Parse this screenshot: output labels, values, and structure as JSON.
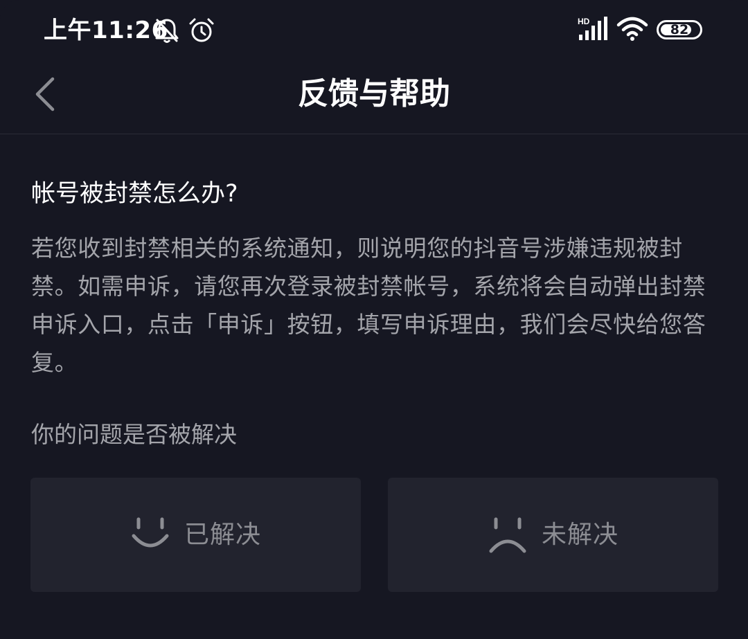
{
  "status_bar": {
    "time": "上午11:26",
    "network_label": "HD",
    "battery": "82",
    "battery_level": 0.82,
    "icons": [
      "bell-muted-icon",
      "alarm-icon",
      "signal-icon",
      "wifi-icon",
      "battery-icon"
    ]
  },
  "header": {
    "title": "反馈与帮助",
    "back_icon": "chevron-left-icon"
  },
  "content": {
    "question": "帐号被封禁怎么办?",
    "answer": "若您收到封禁相关的系统通知，则说明您的抖音号涉嫌违规被封禁。如需申诉，请您再次登录被封禁帐号，系统将会自动弹出封禁申诉入口，点击「申诉」按钮，填写申诉理由，我们会尽快给您答复。",
    "feedback_prompt": "你的问题是否被解决"
  },
  "feedback": {
    "solved_label": "已解决",
    "solved_icon": "smile-icon",
    "unsolved_label": "未解决",
    "unsolved_icon": "frown-icon"
  },
  "colors": {
    "background": "#161722",
    "card": "#22232e",
    "title_text": "#ffffff",
    "body_text": "#a4a5ab",
    "button_text": "#8c8d93"
  }
}
